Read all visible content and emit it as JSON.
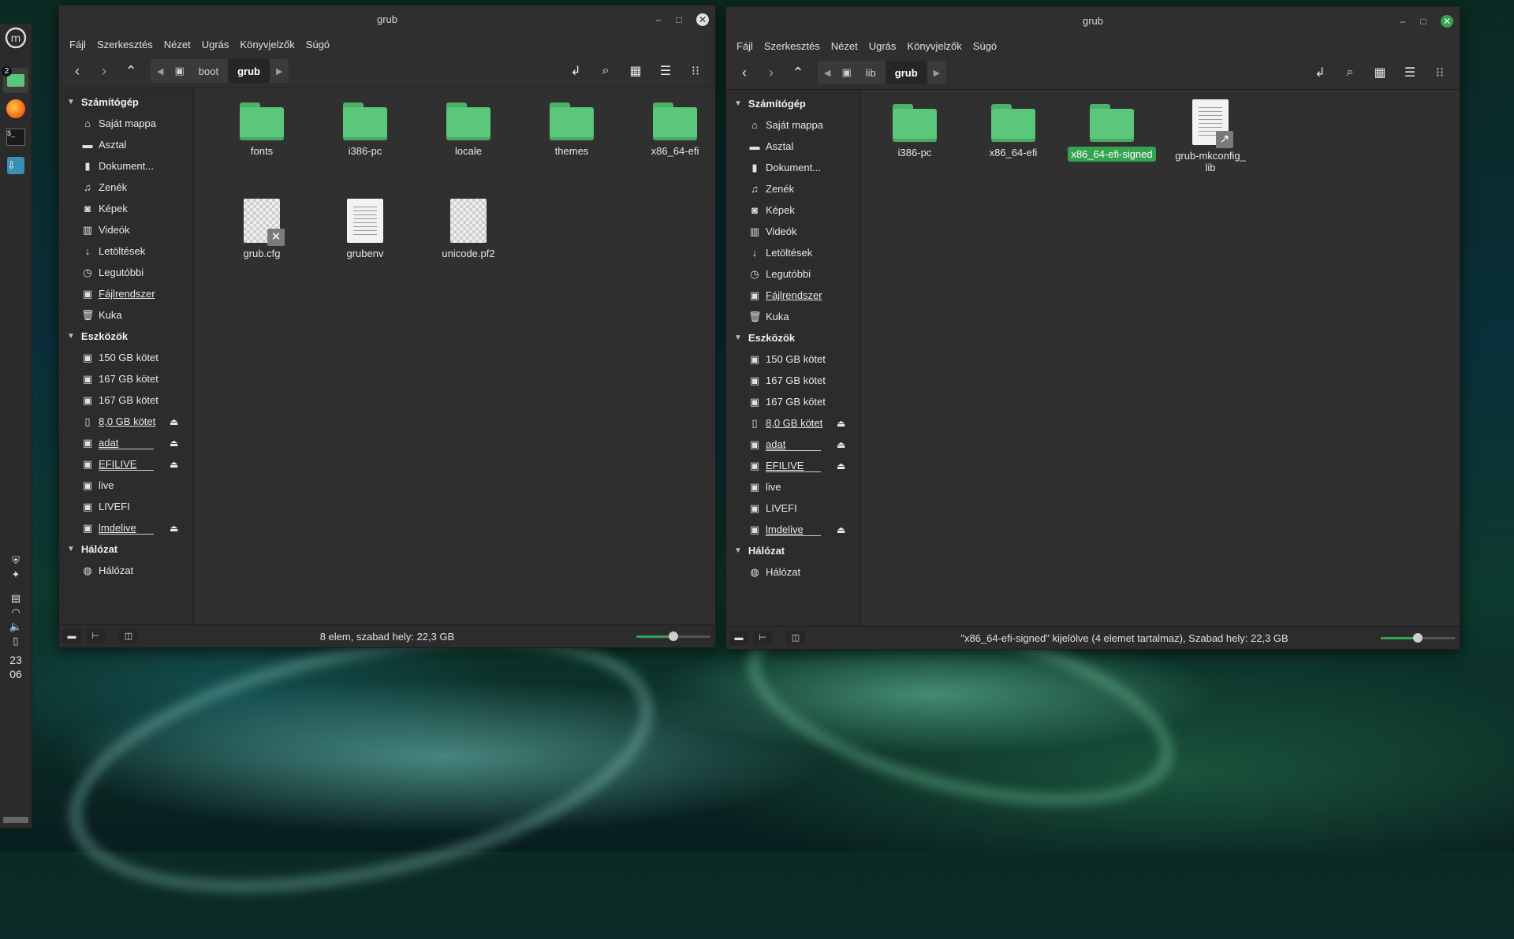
{
  "colors": {
    "accent": "#35a350",
    "folder": "#5ac77a",
    "window_bg": "#303030",
    "sidebar_bg": "#2c2c2c"
  },
  "taskbar": {
    "workspace_badge": "2",
    "clock": {
      "hour": "23",
      "minute": "06"
    }
  },
  "left_window": {
    "title": "grub",
    "menu": [
      "Fájl",
      "Szerkesztés",
      "Nézet",
      "Ugrás",
      "Könyvjelzők",
      "Súgó"
    ],
    "breadcrumbs": {
      "parent": "boot",
      "current": "grub"
    },
    "sidebar": {
      "computer_header": "Számítógép",
      "computer_items": [
        "Saját mappa",
        "Asztal",
        "Dokument...",
        "Zenék",
        "Képek",
        "Videók",
        "Letöltések",
        "Legutóbbi",
        "Fájlrendszer",
        "Kuka"
      ],
      "devices_header": "Eszközök",
      "device_items": [
        "150 GB kötet",
        "167 GB kötet",
        "167 GB kötet",
        "8,0 GB kötet",
        "adat",
        "EFILIVE",
        "live",
        "LIVEFI",
        "lmdelive"
      ],
      "network_header": "Hálózat",
      "network_items": [
        "Hálózat"
      ]
    },
    "files": [
      {
        "name": "fonts",
        "kind": "folder"
      },
      {
        "name": "i386-pc",
        "kind": "folder"
      },
      {
        "name": "locale",
        "kind": "folder"
      },
      {
        "name": "themes",
        "kind": "folder"
      },
      {
        "name": "x86_64-efi",
        "kind": "folder"
      },
      {
        "name": "grub.cfg",
        "kind": "broken-file"
      },
      {
        "name": "grubenv",
        "kind": "text-file"
      },
      {
        "name": "unicode.pf2",
        "kind": "font-file"
      }
    ],
    "status": "8 elem, szabad hely: 22,3 GB",
    "zoom_fraction": 0.5
  },
  "right_window": {
    "title": "grub",
    "menu": [
      "Fájl",
      "Szerkesztés",
      "Nézet",
      "Ugrás",
      "Könyvjelzők",
      "Súgó"
    ],
    "breadcrumbs": {
      "parent": "lib",
      "current": "grub"
    },
    "sidebar": {
      "computer_header": "Számítógép",
      "computer_items": [
        "Saját mappa",
        "Asztal",
        "Dokument...",
        "Zenék",
        "Képek",
        "Videók",
        "Letöltések",
        "Legutóbbi",
        "Fájlrendszer",
        "Kuka"
      ],
      "devices_header": "Eszközök",
      "device_items": [
        "150 GB kötet",
        "167 GB kötet",
        "167 GB kötet",
        "8,0 GB kötet",
        "adat",
        "EFILIVE",
        "live",
        "LIVEFI",
        "lmdelive"
      ],
      "network_header": "Hálózat",
      "network_items": [
        "Hálózat"
      ]
    },
    "files": [
      {
        "name": "i386-pc",
        "kind": "folder"
      },
      {
        "name": "x86_64-efi",
        "kind": "folder"
      },
      {
        "name": "x86_64-efi-signed",
        "kind": "folder",
        "selected": true
      },
      {
        "name_line1": "grub-mkconfig_",
        "name_line2": "lib",
        "kind": "link-file"
      }
    ],
    "status": "\"x86_64-efi-signed\" kijelölve (4 elemet tartalmaz), Szabad hely: 22,3 GB",
    "zoom_fraction": 0.5
  }
}
